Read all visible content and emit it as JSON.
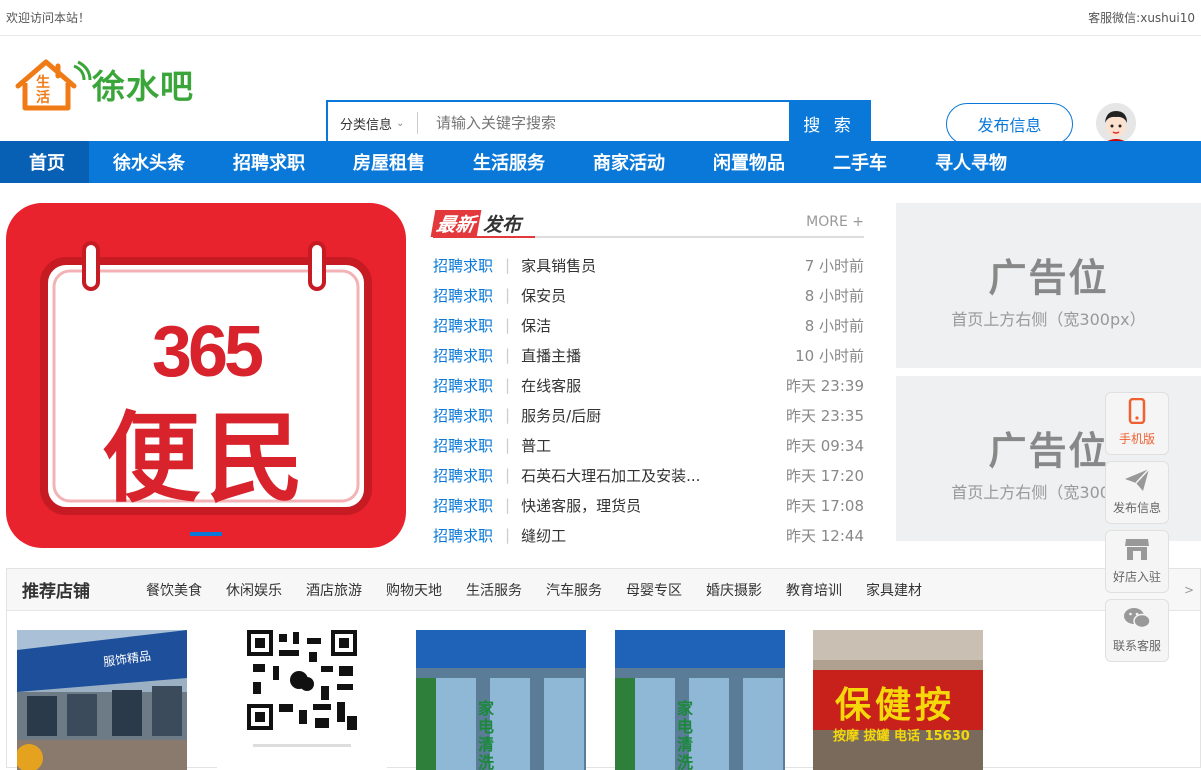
{
  "topbar": {
    "welcome": "欢迎访问本站！",
    "service": "客服微信:xushui10"
  },
  "logo": {
    "badge": "生活",
    "text": "徐水吧"
  },
  "search": {
    "category": "分类信息",
    "placeholder": "请输入关键字搜索",
    "button": "搜 索"
  },
  "header": {
    "publish_label": "发布信息"
  },
  "nav": [
    "首页",
    "徐水头条",
    "招聘求职",
    "房屋租售",
    "生活服务",
    "商家活动",
    "闲置物品",
    "二手车",
    "寻人寻物"
  ],
  "banner": {
    "number": "365",
    "text": "便民"
  },
  "latest": {
    "title_hot": "最新",
    "title_plain": "发布",
    "more": "MORE +",
    "items": [
      {
        "cat": "招聘求职",
        "title": "家具销售员",
        "time": "7 小时前"
      },
      {
        "cat": "招聘求职",
        "title": "保安员",
        "time": "8 小时前"
      },
      {
        "cat": "招聘求职",
        "title": "保洁",
        "time": "8 小时前"
      },
      {
        "cat": "招聘求职",
        "title": "直播主播",
        "time": "10 小时前"
      },
      {
        "cat": "招聘求职",
        "title": "在线客服",
        "time": "昨天 23:39"
      },
      {
        "cat": "招聘求职",
        "title": "服务员/后厨",
        "time": "昨天 23:35"
      },
      {
        "cat": "招聘求职",
        "title": "普工",
        "time": "昨天 09:34"
      },
      {
        "cat": "招聘求职",
        "title": "石英石大理石加工及安装...",
        "time": "昨天 17:20"
      },
      {
        "cat": "招聘求职",
        "title": "快递客服，理货员",
        "time": "昨天 17:08"
      },
      {
        "cat": "招聘求职",
        "title": "缝纫工",
        "time": "昨天 12:44"
      }
    ]
  },
  "ads": [
    {
      "big": "广告位",
      "small": "首页上方右侧（宽300px）"
    },
    {
      "big": "广告位",
      "small": "首页上方右侧（宽300px）"
    }
  ],
  "stores": {
    "title": "推荐店铺",
    "tabs": [
      "餐饮美食",
      "休闲娱乐",
      "酒店旅游",
      "购物天地",
      "生活服务",
      "汽车服务",
      "母婴专区",
      "婚庆摄影",
      "教育培训",
      "家具建材"
    ],
    "more": ">",
    "pics": [
      {
        "sign": "服饰精品"
      },
      {
        "sign": ""
      },
      {
        "sign": "家电清洗"
      },
      {
        "sign": "家电清洗"
      },
      {
        "sign": "保健按",
        "sub": "按摩 拔罐 电话 15630"
      }
    ]
  },
  "float": [
    {
      "label": "手机版",
      "icon": "mobile-icon"
    },
    {
      "label": "发布信息",
      "icon": "paper-plane-icon"
    },
    {
      "label": "好店入驻",
      "icon": "store-icon"
    },
    {
      "label": "联系客服",
      "icon": "wechat-icon"
    }
  ],
  "colors": {
    "primary": "#0a78d8",
    "nav_active": "#0760b4",
    "banner_red": "#e8232e",
    "logo_green": "#3aa63a"
  }
}
